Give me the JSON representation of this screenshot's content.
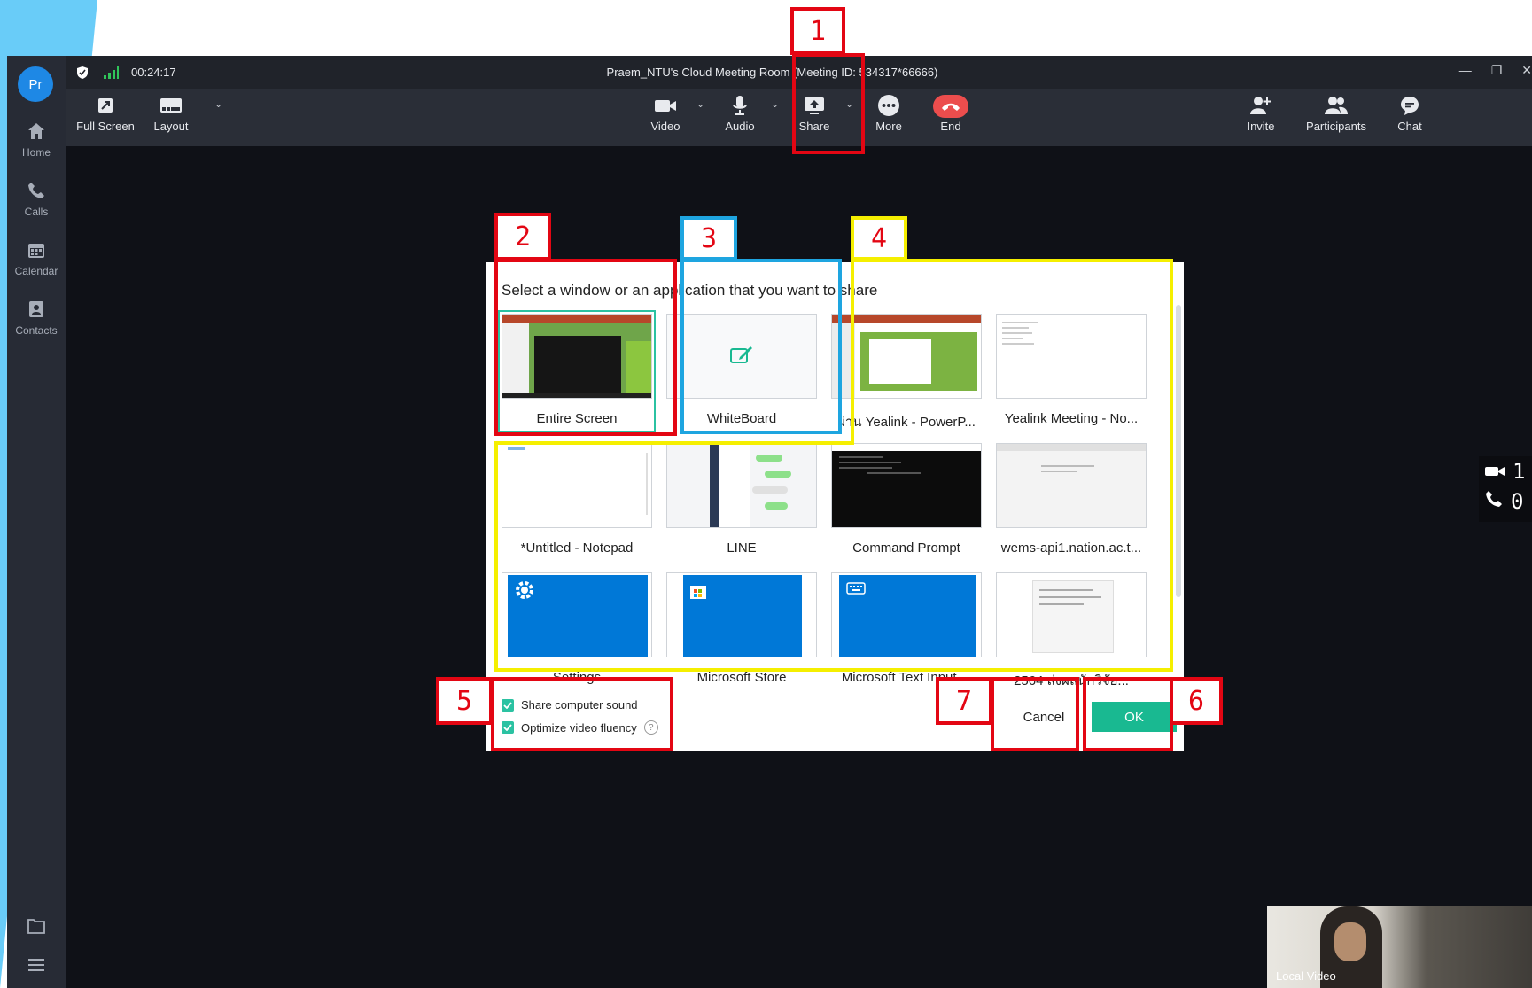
{
  "window": {
    "time": "00:24:17",
    "title": "Praem_NTU's Cloud Meeting Room  (Meeting ID: 534317*66666)"
  },
  "sidebar": {
    "avatar": "Pr",
    "items": [
      {
        "label": "Home",
        "icon": "home-icon"
      },
      {
        "label": "Calls",
        "icon": "phone-icon"
      },
      {
        "label": "Calendar",
        "icon": "calendar-icon"
      },
      {
        "label": "Contacts",
        "icon": "contacts-icon"
      }
    ]
  },
  "toolbar": {
    "left": [
      {
        "label": "Full Screen",
        "icon": "fullscreen-icon"
      },
      {
        "label": "Layout",
        "icon": "layout-icon"
      }
    ],
    "center": [
      {
        "label": "Video",
        "icon": "video-camera-icon"
      },
      {
        "label": "Audio",
        "icon": "microphone-icon"
      },
      {
        "label": "Share",
        "icon": "share-upload-icon"
      },
      {
        "label": "More",
        "icon": "more-icon"
      },
      {
        "label": "End",
        "icon": "hang-up-icon"
      }
    ],
    "right": [
      {
        "label": "Invite",
        "icon": "add-person-icon"
      },
      {
        "label": "Participants",
        "icon": "participants-icon"
      },
      {
        "label": "Chat",
        "icon": "chat-icon"
      }
    ]
  },
  "side_counts": {
    "video": "1",
    "phone": "0"
  },
  "local_video": {
    "label": "Local Video"
  },
  "dialog": {
    "title": "Select a window or an application that you want to share",
    "tiles": [
      {
        "label": "Entire Screen",
        "selected": true
      },
      {
        "label": "WhiteBoard"
      },
      {
        "label": "ผ่าน Yealink - PowerP..."
      },
      {
        "label": "Yealink Meeting - No..."
      },
      {
        "label": "*Untitled - Notepad"
      },
      {
        "label": "LINE"
      },
      {
        "label": "Command Prompt"
      },
      {
        "label": "wems-api1.nation.ac.t..."
      },
      {
        "label": "Settings"
      },
      {
        "label": "Microsoft Store"
      },
      {
        "label": "Microsoft Text Input ..."
      },
      {
        "label": "2564 ส่งผลนักวิจัย..."
      }
    ],
    "options": [
      {
        "label": "Share computer sound",
        "checked": true
      },
      {
        "label": "Optimize video fluency",
        "checked": true
      }
    ],
    "cancel_label": "Cancel",
    "ok_label": "OK"
  },
  "annotations": [
    "1",
    "2",
    "3",
    "4",
    "5",
    "6",
    "7"
  ],
  "colors": {
    "accent": "#19b991",
    "annotation_red": "#e30613",
    "annotation_blue": "#1ea5e0",
    "annotation_yellow": "#f5ef00",
    "end_call": "#ec4d4d"
  }
}
